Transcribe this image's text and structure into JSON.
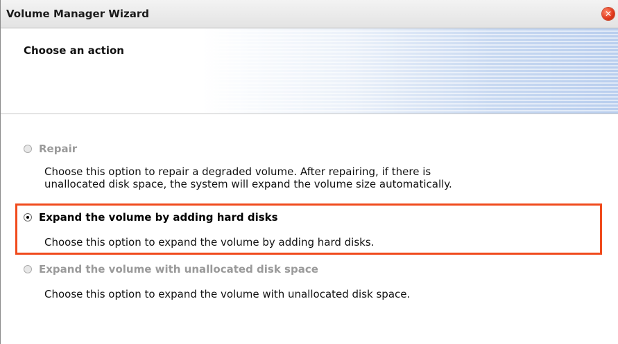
{
  "window": {
    "title": "Volume Manager Wizard",
    "close_symbol": "✕"
  },
  "header": {
    "title": "Choose an action"
  },
  "options": [
    {
      "label": "Repair",
      "selected": false,
      "enabled": false,
      "description_line1": "Choose this option to repair a degraded volume. After repairing, if there is",
      "description_line2": "unallocated disk space, the system will expand the volume size automatically."
    },
    {
      "label": "Expand the volume by adding hard disks",
      "selected": true,
      "enabled": true,
      "description": "Choose this option to expand the volume by adding hard disks."
    },
    {
      "label": "Expand the volume with unallocated disk space",
      "selected": false,
      "enabled": false,
      "description": "Choose this option to expand the volume with unallocated disk space."
    }
  ],
  "colors": {
    "highlight": "#f04a1c",
    "close": "#e0361a"
  }
}
